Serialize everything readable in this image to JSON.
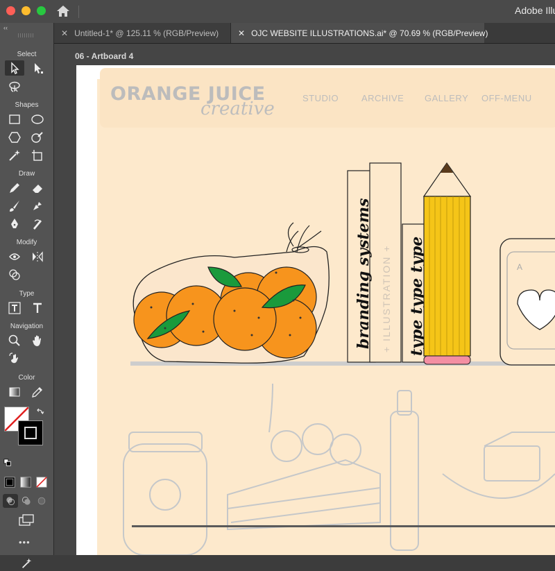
{
  "app": {
    "title": "Adobe Illustrator",
    "colors": {
      "chrome": "#4a4a4a",
      "toolbar": "#535353",
      "canvas": "#454545"
    }
  },
  "toolbar": {
    "sections": {
      "select": "Select",
      "shapes": "Shapes",
      "draw": "Draw",
      "modify": "Modify",
      "type": "Type",
      "navigation": "Navigation",
      "color": "Color"
    },
    "tools": [
      "selection-tool",
      "direct-selection-tool",
      "lasso-tool",
      "rectangle-tool",
      "ellipse-tool",
      "polygon-tool",
      "shaper-tool",
      "magic-wand-tool",
      "artboard-tool",
      "pencil-tool",
      "eraser-tool",
      "paintbrush-tool",
      "blob-brush-tool",
      "pen-tool",
      "curvature-tool",
      "warp-tool",
      "reflect-tool",
      "shape-builder-tool",
      "type-tool",
      "type-on-path-tool",
      "zoom-tool",
      "hand-tool",
      "rotate-view-tool",
      "gradient-tool",
      "eyedropper-tool"
    ],
    "more_label": "•••"
  },
  "tabs": [
    {
      "label": "Untitled-1* @ 125.11 % (RGB/Preview)",
      "active": false
    },
    {
      "label": "OJC WEBSITE ILLUSTRATIONS.ai* @ 70.69 % (RGB/Preview)",
      "active": true
    }
  ],
  "artboard": {
    "label": "06 - Artboard 4",
    "background": "#fde9cc"
  },
  "site": {
    "logo_main": "ORANGE JUICE",
    "logo_sub": "creative",
    "nav": [
      "STUDIO",
      "ARCHIVE",
      "GALLERY",
      "OFF-MENU"
    ]
  },
  "illustration": {
    "book_1": "branding systems",
    "book_2": "+ ILLUSTRATION +",
    "book_3": "type type type",
    "orange_color": "#f7941d",
    "leaf_color": "#1a9a3c",
    "pencil_color": "#f5c518"
  }
}
